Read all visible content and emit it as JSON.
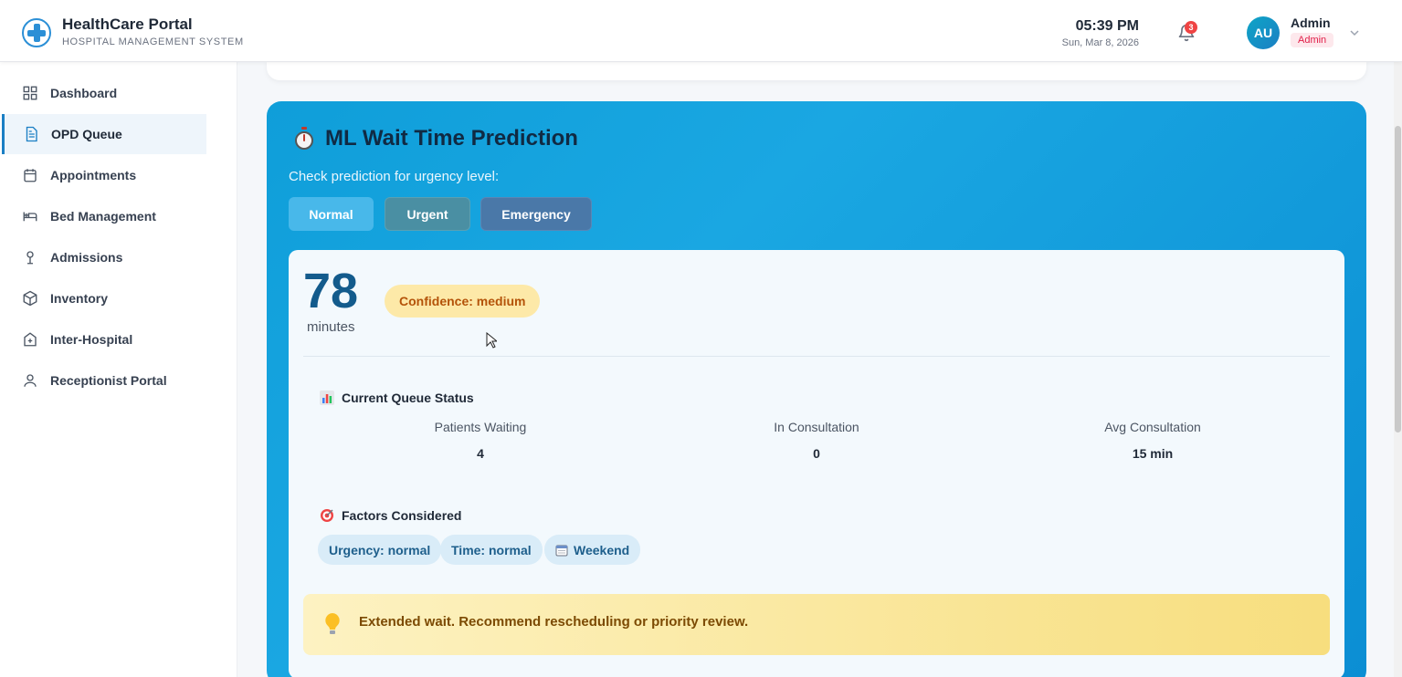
{
  "header": {
    "app_title": "HealthCare Portal",
    "app_subtitle": "HOSPITAL MANAGEMENT SYSTEM",
    "time": "05:39 PM",
    "date": "Sun, Mar 8, 2026",
    "notification_count": "3",
    "avatar_initials": "AU",
    "user_name": "Admin",
    "user_role": "Admin"
  },
  "sidebar": {
    "items": [
      {
        "label": "Dashboard",
        "icon": "grid-icon"
      },
      {
        "label": "OPD Queue",
        "icon": "document-icon",
        "active": true
      },
      {
        "label": "Appointments",
        "icon": "calendar-icon"
      },
      {
        "label": "Bed Management",
        "icon": "bed-icon"
      },
      {
        "label": "Admissions",
        "icon": "admission-icon"
      },
      {
        "label": "Inventory",
        "icon": "box-icon"
      },
      {
        "label": "Inter-Hospital",
        "icon": "hospital-icon"
      },
      {
        "label": "Receptionist Portal",
        "icon": "user-icon"
      }
    ]
  },
  "ml_panel": {
    "title": "ML Wait Time Prediction",
    "subtitle": "Check prediction for urgency level:",
    "buttons": {
      "normal": "Normal",
      "urgent": "Urgent",
      "emergency": "Emergency"
    },
    "prediction": {
      "value": "78",
      "unit": "minutes",
      "confidence": "Confidence: medium"
    },
    "queue_status": {
      "title": "Current Queue Status",
      "stats": [
        {
          "label": "Patients Waiting",
          "value": "4"
        },
        {
          "label": "In Consultation",
          "value": "0"
        },
        {
          "label": "Avg Consultation",
          "value": "15 min"
        }
      ]
    },
    "factors": {
      "title": "Factors Considered",
      "chips": [
        "Urgency: normal",
        "Time: normal",
        "Weekend"
      ]
    },
    "advice": "Extended wait. Recommend rescheduling or priority review."
  },
  "colors": {
    "accent": "#1b7fc4",
    "panel_gradient_start": "#0f9ed9",
    "confidence_bg": "#fde9a8",
    "advice_bg": "#f7de7e"
  }
}
